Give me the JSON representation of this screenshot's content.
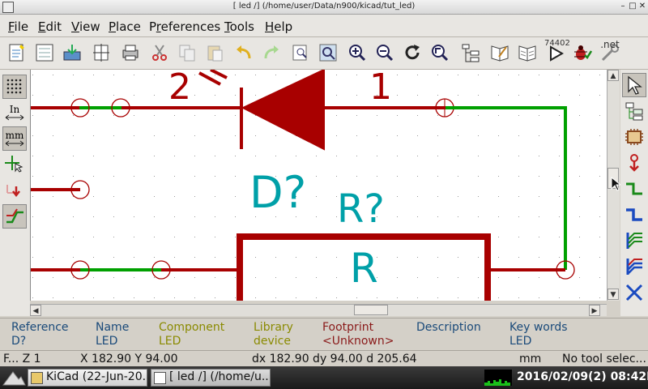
{
  "window": {
    "title": "[ led /] (/home/user/Data/n900/kicad/tut_led)"
  },
  "menu": {
    "items": [
      {
        "label": "File",
        "accel": "F"
      },
      {
        "label": "Edit",
        "accel": "E"
      },
      {
        "label": "View",
        "accel": "V"
      },
      {
        "label": "Place",
        "accel": "P"
      },
      {
        "label": "Preferences",
        "accel": "r"
      },
      {
        "label": "Tools",
        "accel": "T"
      },
      {
        "label": "Help",
        "accel": "H"
      }
    ]
  },
  "toolbar": {
    "part_number_label": "74402",
    "net_label": ".net"
  },
  "left_toolbar": {
    "units_in_label": "In",
    "units_mm_label": "mm"
  },
  "schematic": {
    "pin_number_left": "2",
    "pin_number_right": "1",
    "diode_reference": "D?",
    "resistor_reference": "R?",
    "resistor_value": "R",
    "colors": {
      "wire": "#00a000",
      "body": "#a80000",
      "text": "#00a0a8"
    }
  },
  "info": {
    "reference": {
      "label": "Reference",
      "value": "D?"
    },
    "name": {
      "label": "Name",
      "value": "LED"
    },
    "component": {
      "label": "Component",
      "value": "LED"
    },
    "library": {
      "label": "Library",
      "value": "device"
    },
    "footprint": {
      "label": "Footprint",
      "value": "<Unknown>"
    },
    "description": {
      "label": "Description",
      "value": ""
    },
    "keywords": {
      "label": "Key words",
      "value": "LED"
    }
  },
  "status": {
    "zoom": "F... Z 1",
    "xy": "X 182.90  Y 94.00",
    "delta": "dx 182.90  dy 94.00  d 205.64",
    "units": "mm",
    "tool": "No tool selec..."
  },
  "taskbar": {
    "tasks": [
      {
        "label": "KiCad (22-Jun-20..."
      },
      {
        "label": "[ led /] (/home/u..."
      }
    ],
    "clock": "2016/02/09(2) 08:42PM"
  }
}
